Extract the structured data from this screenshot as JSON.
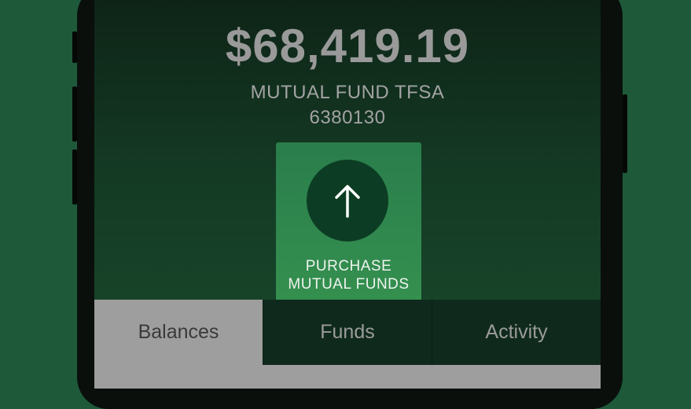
{
  "account": {
    "balance": "$68,419.19",
    "name": "MUTUAL FUND TFSA",
    "number": "6380130"
  },
  "purchase": {
    "icon": "arrow-up-icon",
    "label_line1": "PURCHASE",
    "label_line2": "MUTUAL FUNDS"
  },
  "tabs": [
    {
      "label": "Balances",
      "active": true
    },
    {
      "label": "Funds",
      "active": false
    },
    {
      "label": "Activity",
      "active": false
    }
  ],
  "colors": {
    "brand_green": "#2a7d4c",
    "icon_circle": "#0c3d24",
    "background": "#1e5a3a"
  }
}
